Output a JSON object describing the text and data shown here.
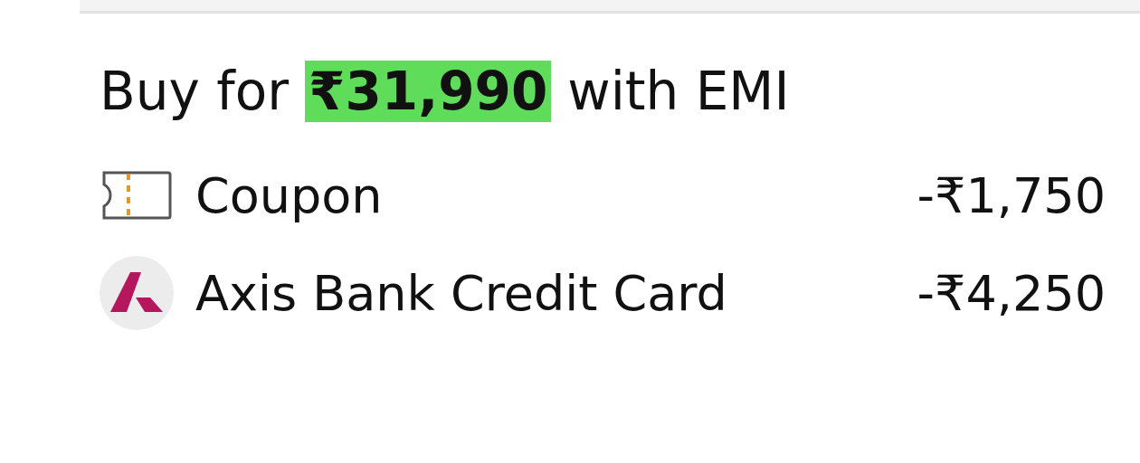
{
  "offer": {
    "prefix": "Buy for",
    "price": "₹31,990",
    "suffix": "with EMI"
  },
  "discounts": [
    {
      "kind": "coupon",
      "label": "Coupon",
      "amount": "-₹1,750"
    },
    {
      "kind": "bank",
      "label": "Axis Bank Credit Card",
      "amount": "-₹4,250"
    }
  ]
}
